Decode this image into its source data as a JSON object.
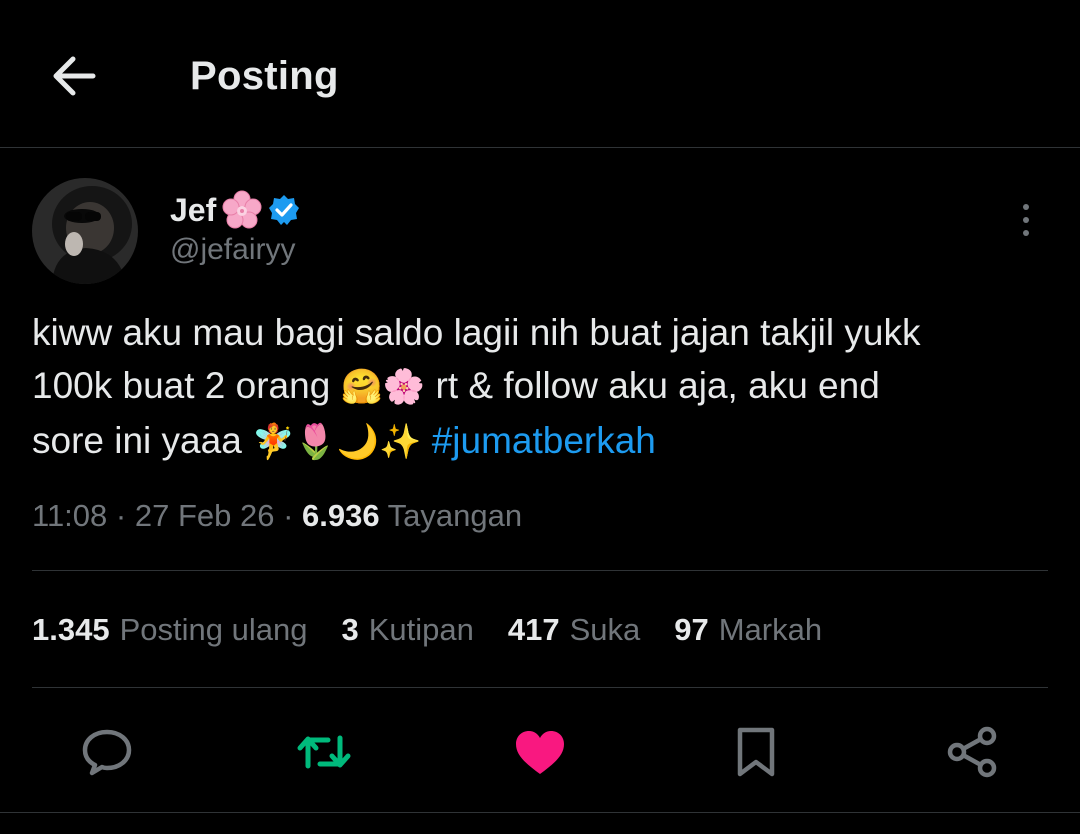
{
  "header": {
    "title": "Posting"
  },
  "author": {
    "name": "Jef",
    "handle": "@jefairyy"
  },
  "tweet": {
    "line1": "kiww aku mau bagi saldo lagii nih buat jajan takjil yukk",
    "line2a": "100k buat 2 orang ",
    "line2_emojis": "🤗🌸",
    "line2b": " rt & follow aku aja, aku end",
    "line3a": "sore ini yaaa ",
    "line3_emojis": "🧚🌷🌙✨",
    "hashtag": "#jumatberkah"
  },
  "meta": {
    "time": "11:08",
    "date": "27 Feb 26",
    "views": "6.936",
    "views_label": "Tayangan"
  },
  "stats": {
    "reposts": "1.345",
    "reposts_label": "Posting ulang",
    "quotes": "3",
    "quotes_label": "Kutipan",
    "likes": "417",
    "likes_label": "Suka",
    "bookmarks": "97",
    "bookmarks_label": "Markah"
  },
  "colors": {
    "accent": "#1d9bf0",
    "repost": "#00ba7c",
    "like": "#f91880",
    "verified": "#1d9bf0"
  }
}
